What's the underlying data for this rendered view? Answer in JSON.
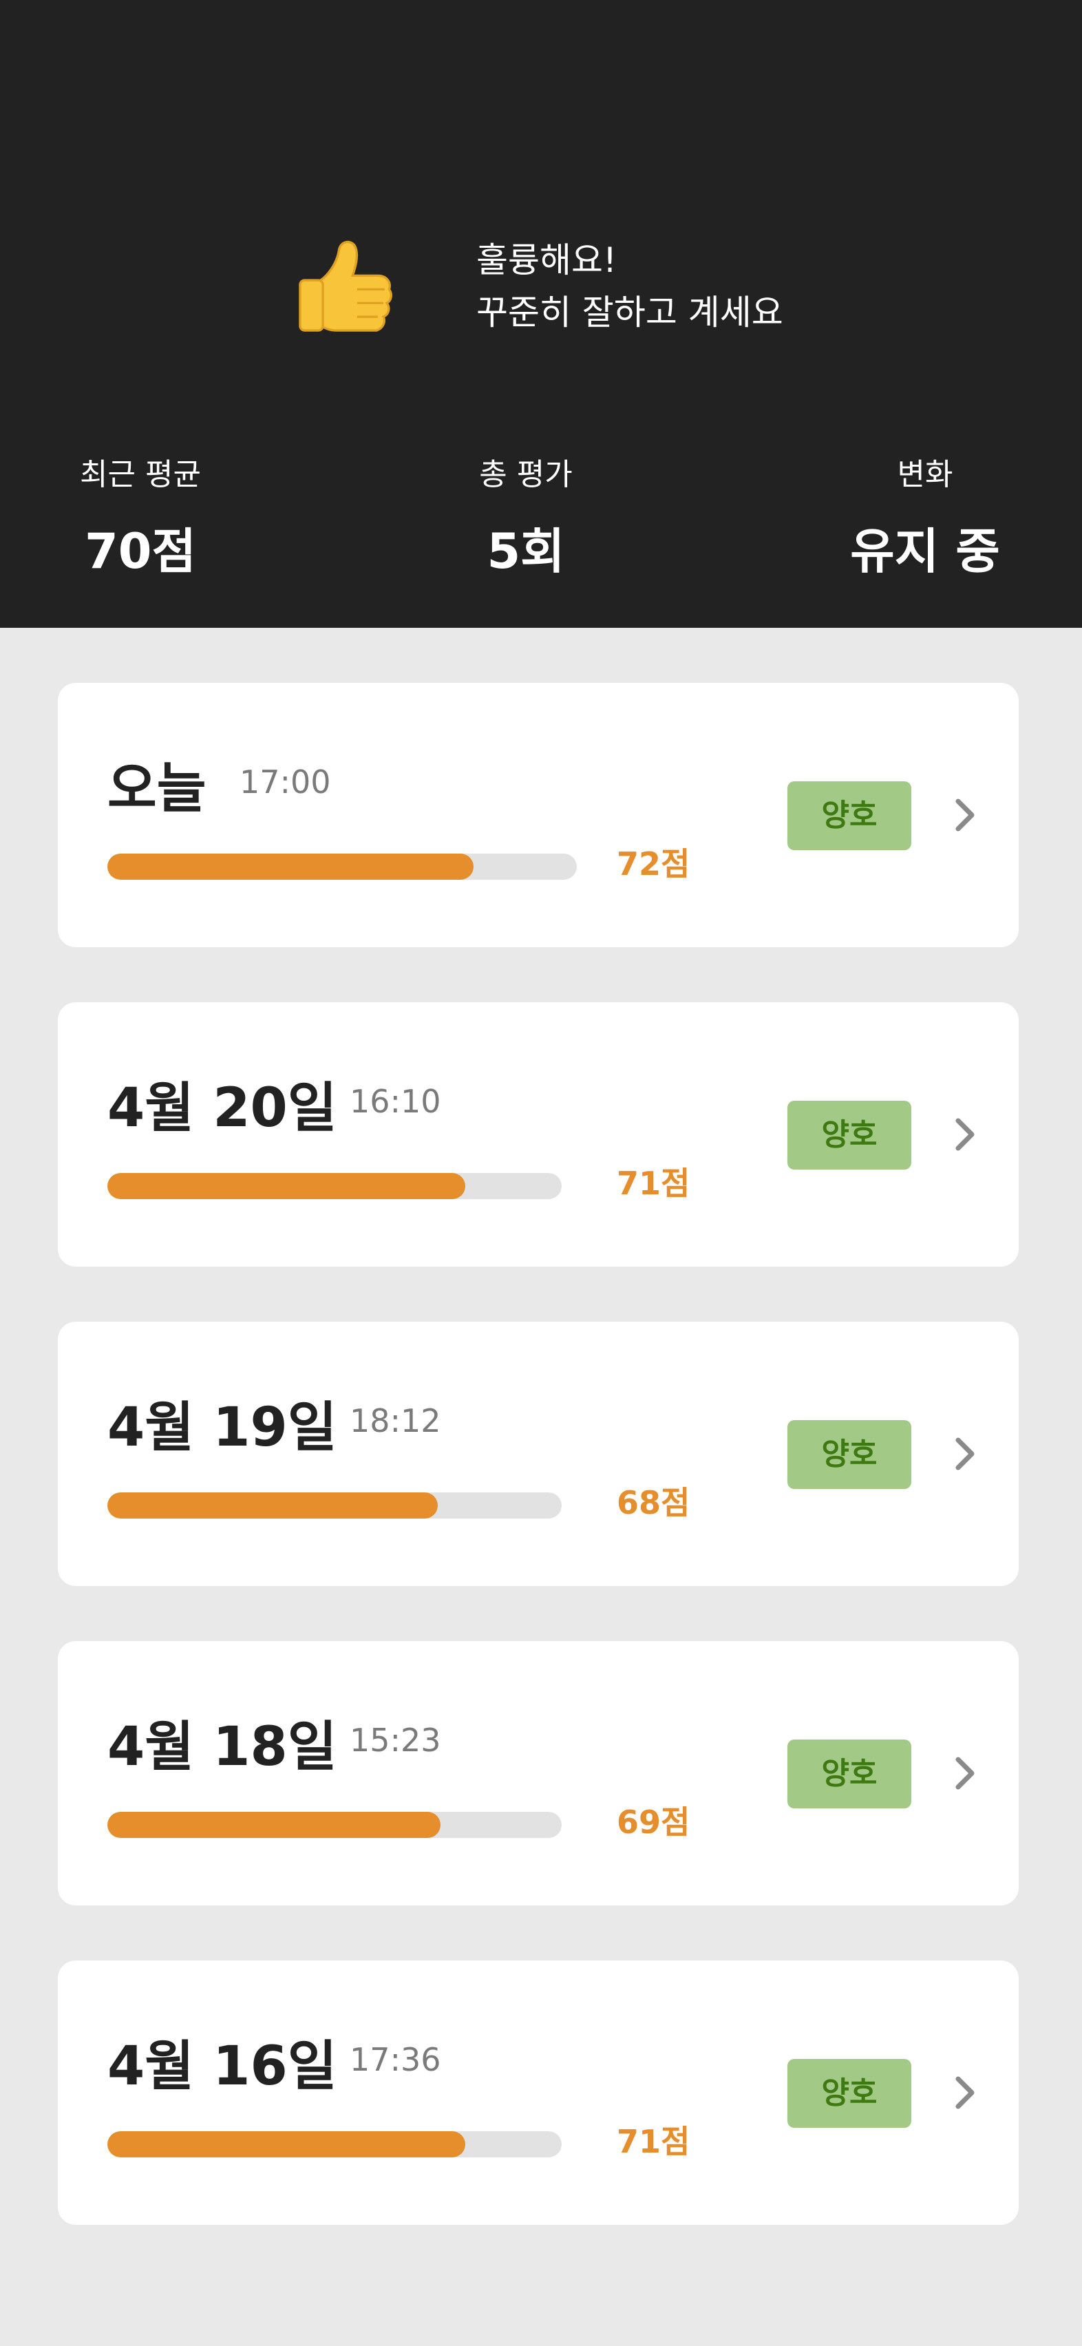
{
  "hero": {
    "line1": "훌륭해요!",
    "line2": "꾸준히 잘하고 계세요",
    "icon": "thumbs-up-icon"
  },
  "stats": {
    "average": {
      "label": "최근 평균",
      "value": "70점"
    },
    "total": {
      "label": "총 평가",
      "value": "5회"
    },
    "change": {
      "label": "변화",
      "value": "유지 중"
    }
  },
  "colors": {
    "header_bg": "#222222",
    "page_bg": "#e9e9e9",
    "accent": "#e58e2b",
    "badge_bg": "#a2c985",
    "badge_text": "#3d7a12"
  },
  "records": [
    {
      "date": "오늘",
      "time": "17:00",
      "score": "72점",
      "score_value": 72,
      "status": "양호"
    },
    {
      "date": "4월 20일",
      "time": "16:10",
      "score": "71점",
      "score_value": 71,
      "status": "양호"
    },
    {
      "date": "4월 19일",
      "time": "18:12",
      "score": "68점",
      "score_value": 68,
      "status": "양호"
    },
    {
      "date": "4월 18일",
      "time": "15:23",
      "score": "69점",
      "score_value": 69,
      "status": "양호"
    },
    {
      "date": "4월 16일",
      "time": "17:36",
      "score": "71점",
      "score_value": 71,
      "status": "양호"
    }
  ]
}
